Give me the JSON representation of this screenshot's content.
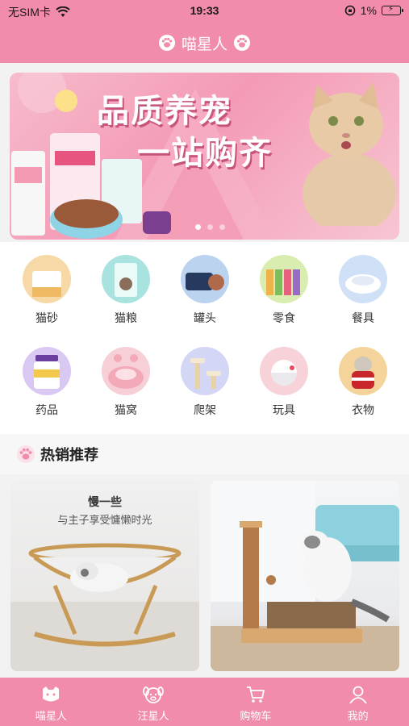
{
  "status_bar": {
    "carrier": "无SIM卡",
    "time": "19:33",
    "battery": "1%"
  },
  "header": {
    "title": "喵星人"
  },
  "banner": {
    "line1": "品质养宠",
    "line2": "一站购齐",
    "page_count": 3,
    "active_page": 1
  },
  "categories": [
    {
      "label": "猫砂",
      "icon": "cat-litter-icon",
      "color": "#f7d9a8"
    },
    {
      "label": "猫粮",
      "icon": "cat-food-icon",
      "color": "#a8e3df"
    },
    {
      "label": "罐头",
      "icon": "canned-food-icon",
      "color": "#bcd3f0"
    },
    {
      "label": "零食",
      "icon": "snacks-icon",
      "color": "#d9edb0"
    },
    {
      "label": "餐具",
      "icon": "pet-bowl-icon",
      "color": "#cfe0f7"
    },
    {
      "label": "药品",
      "icon": "medicine-icon",
      "color": "#d8c8f2"
    },
    {
      "label": "猫窝",
      "icon": "cat-bed-icon",
      "color": "#f7cfd6"
    },
    {
      "label": "爬架",
      "icon": "cat-tree-icon",
      "color": "#d3d6f4"
    },
    {
      "label": "玩具",
      "icon": "toy-ball-icon",
      "color": "#f7d2d8"
    },
    {
      "label": "衣物",
      "icon": "clothing-icon",
      "color": "#f4d49a"
    }
  ],
  "hot_section": {
    "title": "热销推荐"
  },
  "products": [
    {
      "title": "慢一些",
      "subtitle": "与主子享受慵懒时光"
    },
    {
      "title": "",
      "subtitle": ""
    }
  ],
  "tabs": [
    {
      "label": "喵星人",
      "icon": "cat-face-icon"
    },
    {
      "label": "汪星人",
      "icon": "dog-face-icon"
    },
    {
      "label": "购物车",
      "icon": "cart-icon"
    },
    {
      "label": "我的",
      "icon": "user-icon"
    }
  ],
  "colors": {
    "brand": "#f18cab",
    "white": "#ffffff"
  }
}
